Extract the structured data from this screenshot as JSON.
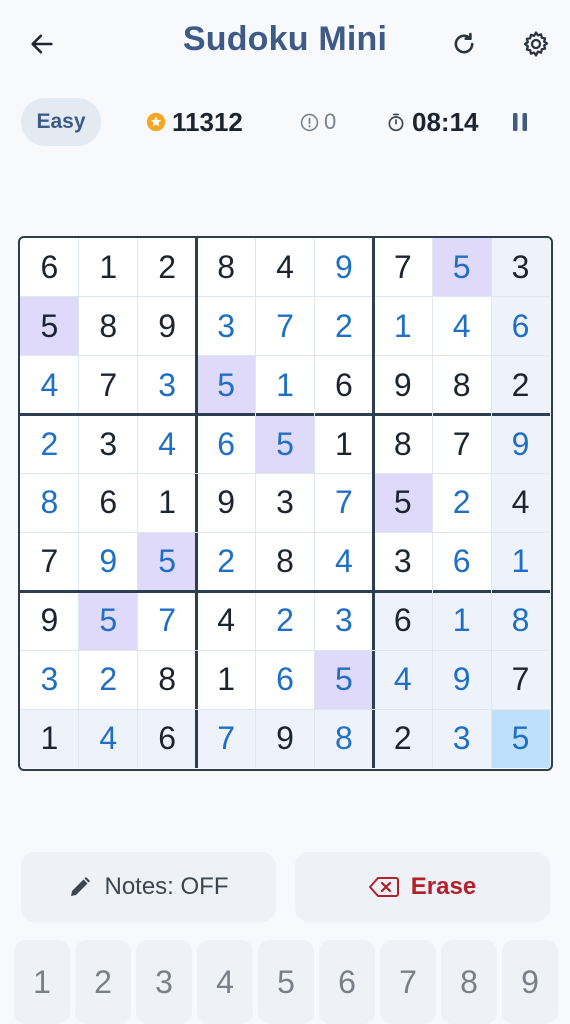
{
  "app": {
    "title": "Sudoku Mini"
  },
  "header": {
    "back_icon": "arrow-left-icon",
    "restart_icon": "refresh-icon",
    "settings_icon": "gear-icon"
  },
  "stats": {
    "difficulty": "Easy",
    "score": "11312",
    "score_icon": "star-coin-icon",
    "mistakes": "0",
    "mistakes_icon": "alert-circle-icon",
    "timer": "08:14",
    "timer_icon": "stopwatch-icon",
    "pause_icon": "pause-icon"
  },
  "board": {
    "rows": [
      [
        "6",
        "1",
        "2",
        "8",
        "4",
        "9",
        "7",
        "5",
        "3"
      ],
      [
        "5",
        "8",
        "9",
        "3",
        "7",
        "2",
        "1",
        "4",
        "6"
      ],
      [
        "4",
        "7",
        "3",
        "5",
        "1",
        "6",
        "9",
        "8",
        "2"
      ],
      [
        "2",
        "3",
        "4",
        "6",
        "5",
        "1",
        "8",
        "7",
        "9"
      ],
      [
        "8",
        "6",
        "1",
        "9",
        "3",
        "7",
        "5",
        "2",
        "4"
      ],
      [
        "7",
        "9",
        "5",
        "2",
        "8",
        "4",
        "3",
        "6",
        "1"
      ],
      [
        "9",
        "5",
        "7",
        "4",
        "2",
        "3",
        "6",
        "1",
        "8"
      ],
      [
        "3",
        "2",
        "8",
        "1",
        "6",
        "5",
        "4",
        "9",
        "7"
      ],
      [
        "1",
        "4",
        "6",
        "7",
        "9",
        "8",
        "2",
        "3",
        "5"
      ]
    ],
    "user_entered": [
      "0,5",
      "0,7",
      "1,3",
      "1,4",
      "1,5",
      "1,6",
      "1,7",
      "1,8",
      "2,0",
      "2,2",
      "2,3",
      "2,4",
      "3,0",
      "3,2",
      "3,3",
      "3,4",
      "3,8",
      "4,0",
      "4,5",
      "4,7",
      "5,1",
      "5,2",
      "5,3",
      "5,5",
      "5,7",
      "5,8",
      "6,1",
      "6,2",
      "6,4",
      "6,5",
      "6,7",
      "6,8",
      "7,0",
      "7,1",
      "7,4",
      "7,5",
      "7,6",
      "7,7",
      "8,1",
      "8,3",
      "8,5",
      "8,7",
      "8,8"
    ],
    "selected": "8,8",
    "highlight_digit": "5",
    "colors": {
      "given": "#1c2430",
      "user": "#1f6fc4",
      "same_digit_bg": "#e0dafa",
      "related_bg": "#eef3fb",
      "selected_bg": "#bfe0fb"
    }
  },
  "actions": {
    "notes_label": "Notes: OFF",
    "notes_icon": "pencil-icon",
    "erase_label": "Erase",
    "erase_icon": "backspace-icon",
    "erase_color": "#b3202b"
  },
  "numpad": [
    "1",
    "2",
    "3",
    "4",
    "5",
    "6",
    "7",
    "8",
    "9"
  ]
}
